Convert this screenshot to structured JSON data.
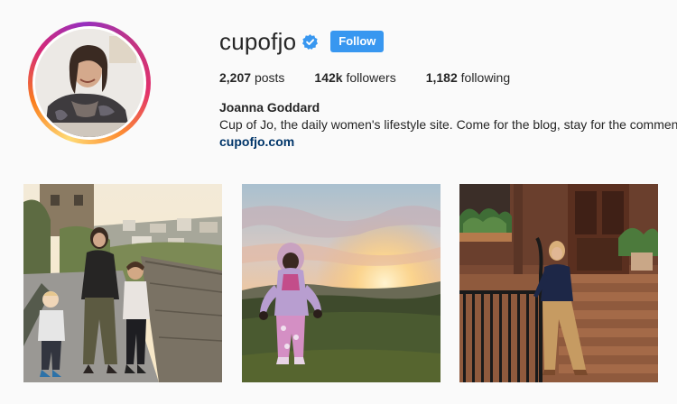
{
  "profile": {
    "username": "cupofjo",
    "verified": true,
    "follow_label": "Follow",
    "avatar_icon": "profile-photo"
  },
  "stats": {
    "posts_count": "2,207",
    "posts_label": "posts",
    "followers_count": "142k",
    "followers_label": "followers",
    "following_count": "1,182",
    "following_label": "following"
  },
  "bio": {
    "full_name": "Joanna Goddard",
    "text": "Cup of Jo, the daily women's lifestyle site. Come for the blog, stay for the comments.",
    "link": "cupofjo.com"
  },
  "colors": {
    "accent": "#3897f0",
    "link": "#003569",
    "text": "#262626",
    "background": "#fafafa"
  },
  "posts": [
    {
      "alt_icon": "photo-family-walk"
    },
    {
      "alt_icon": "photo-child-sunset"
    },
    {
      "alt_icon": "photo-woman-stoop"
    }
  ]
}
